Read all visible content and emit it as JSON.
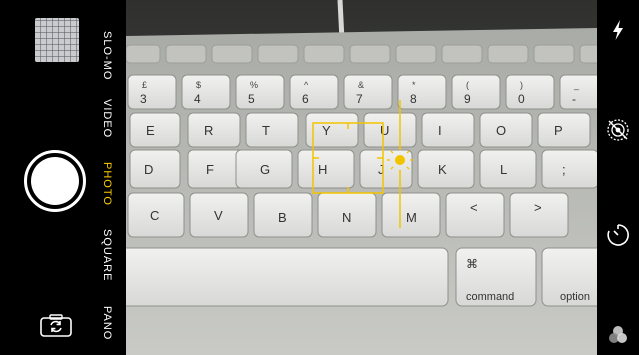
{
  "modes": [
    {
      "label": "SLO-MO",
      "active": false
    },
    {
      "label": "VIDEO",
      "active": false
    },
    {
      "label": "PHOTO",
      "active": true
    },
    {
      "label": "SQUARE",
      "active": false
    },
    {
      "label": "PANO",
      "active": false
    }
  ],
  "keyboard": {
    "number_row": [
      "3",
      "4",
      "5",
      "6",
      "7",
      "8",
      "9",
      "0",
      "-"
    ],
    "number_row_symbols": [
      "£",
      "$",
      "%",
      "^",
      "&",
      "*",
      "(",
      ")",
      "_"
    ],
    "top_row": [
      "E",
      "R",
      "T",
      "Y",
      "U",
      "I",
      "O",
      "P"
    ],
    "home_row": [
      "D",
      "F",
      "G",
      "H",
      "J",
      "K",
      "L",
      ";"
    ],
    "bottom_row": [
      "C",
      "V",
      "B",
      "N",
      "M",
      "<",
      ">"
    ],
    "command_symbol": "⌘",
    "command_label": "command",
    "option_label": "option"
  },
  "colors": {
    "accent": "#ffcc00",
    "focus": "#f2c400"
  },
  "icons": {
    "flash": "flash-icon",
    "live_photo": "live-photo-off-icon",
    "timer": "timer-icon",
    "filters": "filters-icon",
    "switch_camera": "switch-camera-icon"
  }
}
